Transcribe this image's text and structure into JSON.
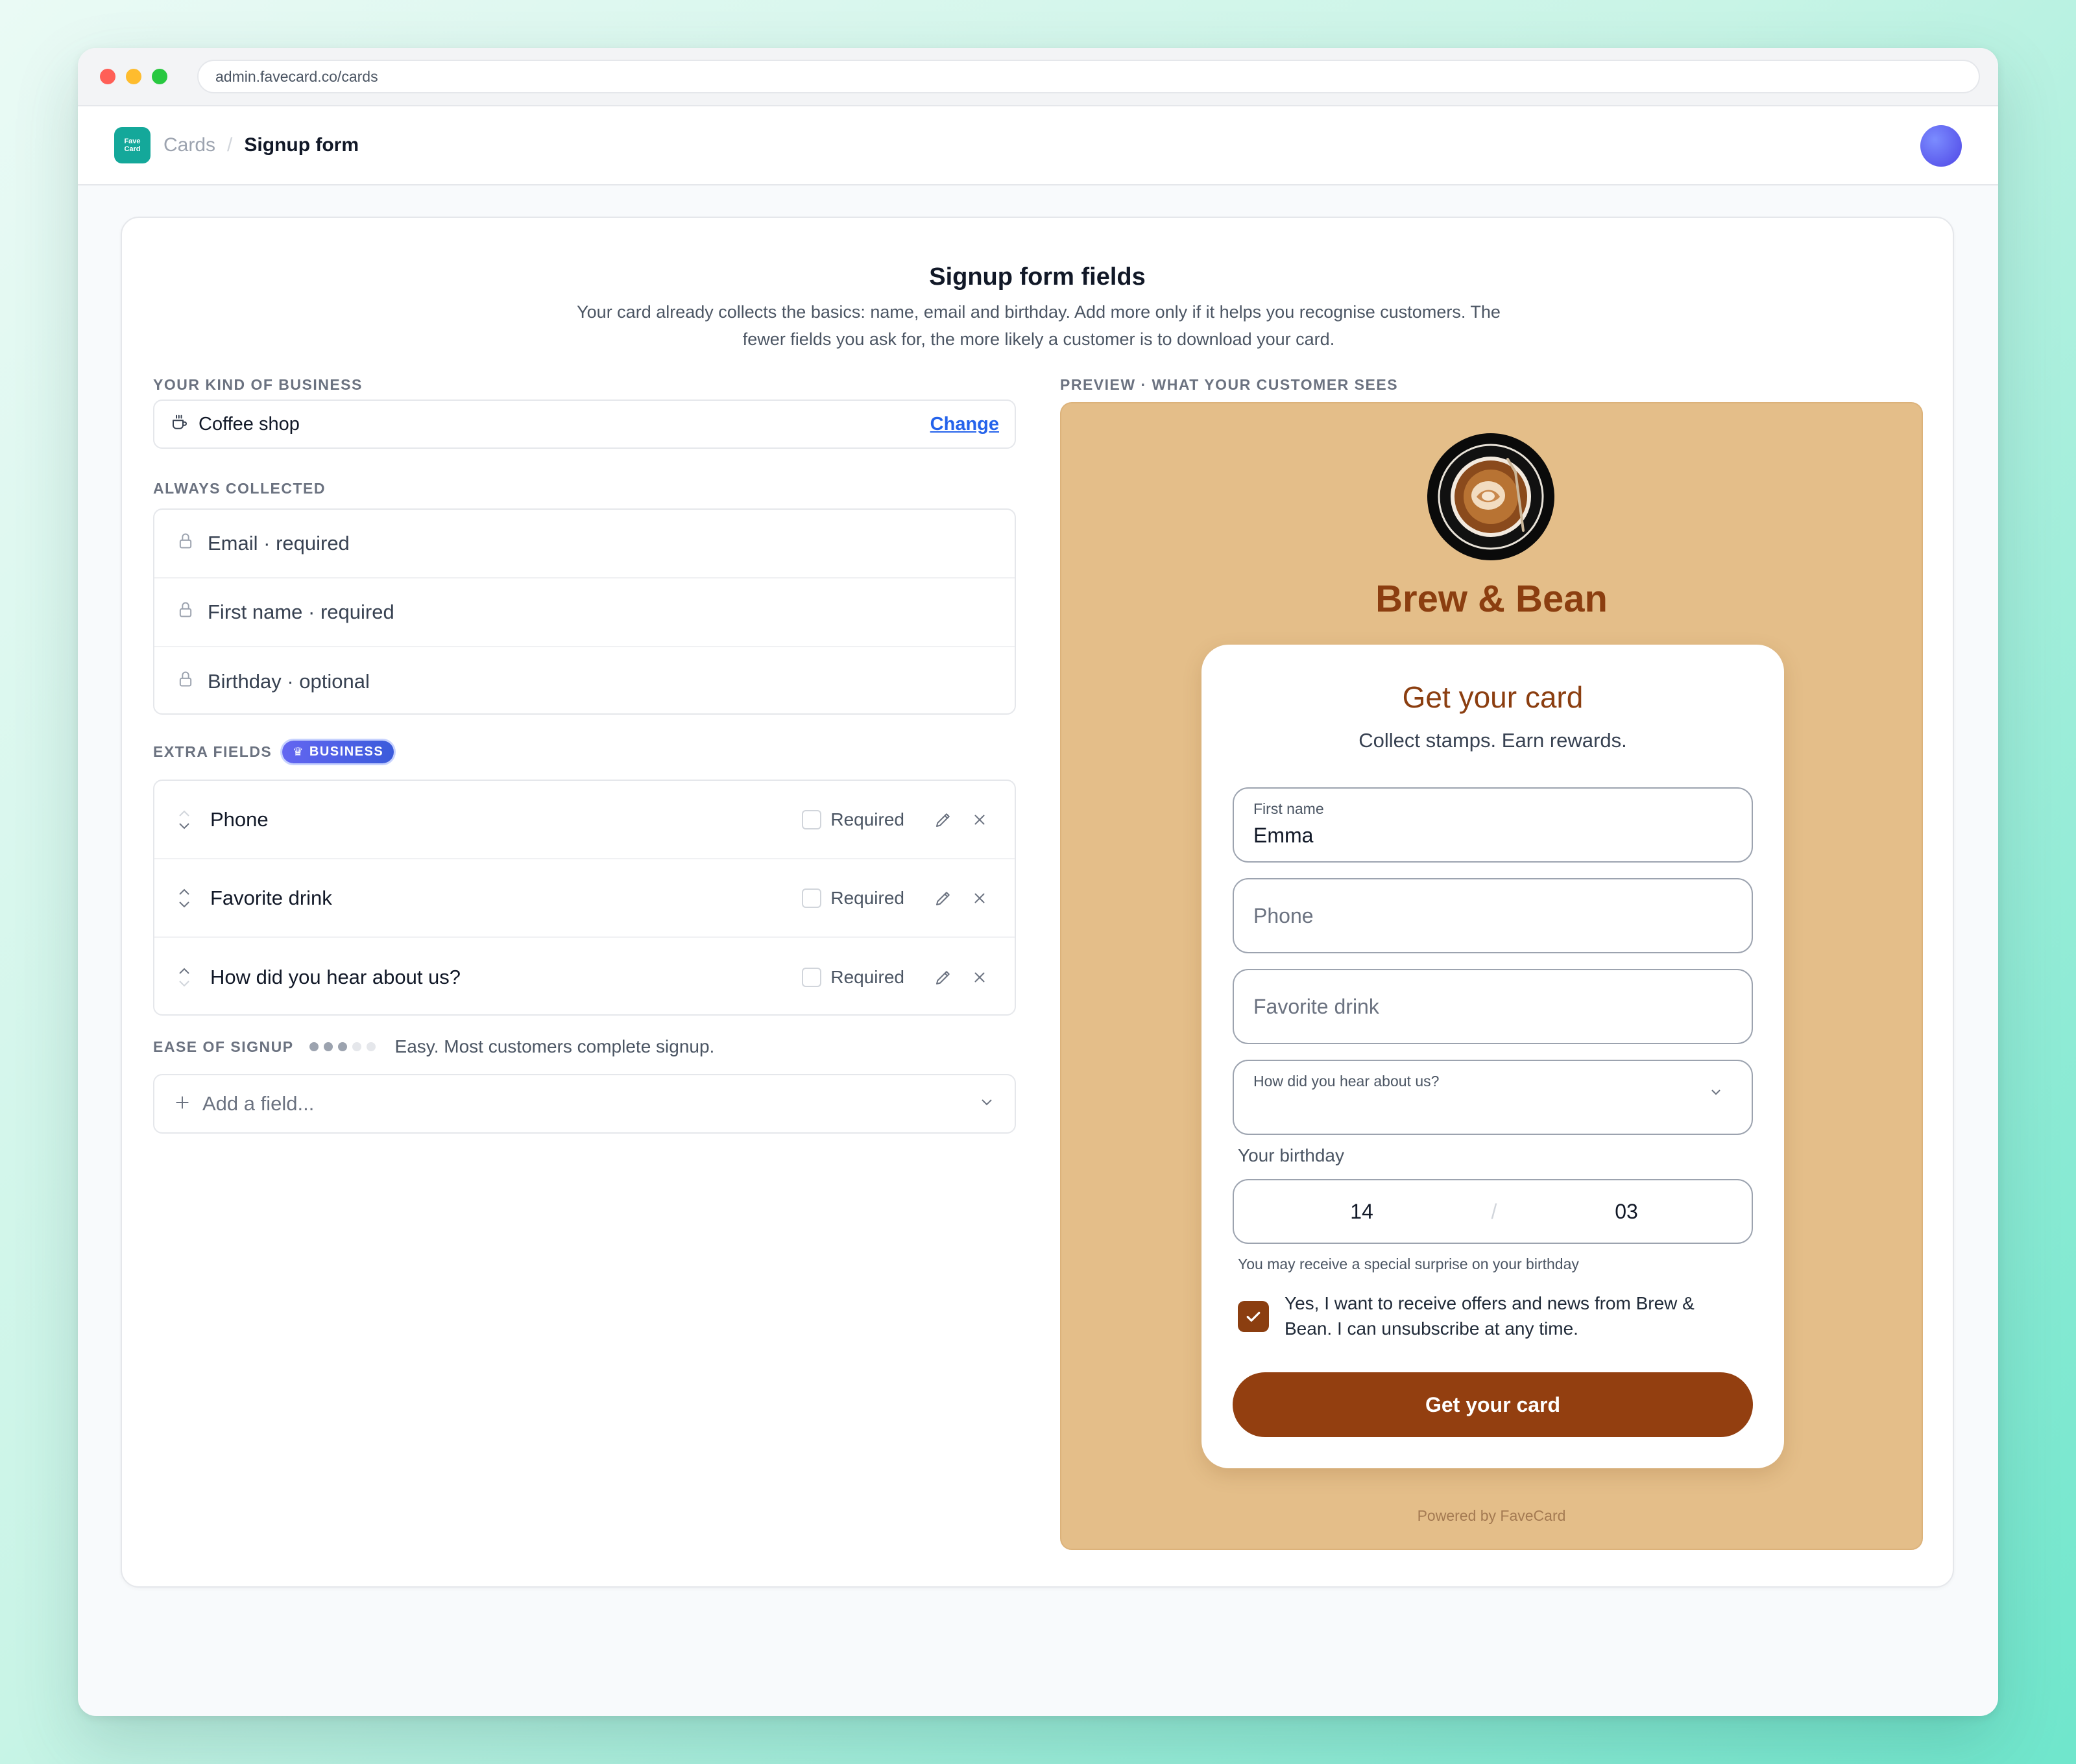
{
  "browser": {
    "url": "admin.favecard.co/cards"
  },
  "appbar": {
    "logo_line1": "Fave",
    "logo_line2": "Card",
    "breadcrumb": [
      "Cards",
      "Signup form"
    ],
    "separator": "/"
  },
  "main": {
    "title": "Signup form fields",
    "description": "Your card already collects the basics: name, email and birthday. Add more only if it helps you recognise customers. The fewer fields you ask for, the more likely a customer is to download your card."
  },
  "business": {
    "label": "YOUR KIND OF BUSINESS",
    "value": "Coffee shop",
    "icon": "coffee-cup-icon",
    "change_label": "Change"
  },
  "always_collected": {
    "label": "ALWAYS COLLECTED",
    "items": [
      {
        "label": "Email · required",
        "icon": "lock-icon"
      },
      {
        "label": "First name · required",
        "icon": "lock-icon"
      },
      {
        "label": "Birthday · optional",
        "icon": "lock-icon"
      }
    ]
  },
  "extra_fields": {
    "label": "EXTRA FIELDS",
    "badge": "BUSINESS",
    "required_label": "Required",
    "items": [
      {
        "name": "Phone",
        "required": false
      },
      {
        "name": "Favorite drink",
        "required": false
      },
      {
        "name": "How did you hear about us?",
        "required": false
      }
    ]
  },
  "ease": {
    "label": "EASE OF SIGNUP",
    "level": 3,
    "max": 5,
    "text": "Easy. Most customers complete signup."
  },
  "add_field": {
    "placeholder": "Add a field..."
  },
  "preview": {
    "label": "PREVIEW · WHAT YOUR CUSTOMER SEES",
    "brand_name": "Brew & Bean",
    "title": "Get your card",
    "subtitle": "Collect stamps. Earn rewards.",
    "first_name_label": "First name",
    "first_name_value": "Emma",
    "phone_placeholder": "Phone",
    "drink_placeholder": "Favorite drink",
    "hear_label": "How did you hear about us?",
    "birthday_label": "Your birthday",
    "birthday_day": "14",
    "birthday_sep": "/",
    "birthday_month": "03",
    "birthday_hint": "You may receive a special surprise on your birthday",
    "consent_checked": true,
    "consent_text": "Yes, I want to receive offers and news from Brew & Bean. I can unsubscribe at any time.",
    "submit_label": "Get your card",
    "powered_by": "Powered by FaveCard"
  },
  "colors": {
    "brand_teal": "#14a89a",
    "preview_bg": "#e4be89",
    "brand_brown": "#8b3e10",
    "button_brown": "#933f10",
    "link_blue": "#2563eb",
    "badge_indigo": "#6366f1"
  }
}
